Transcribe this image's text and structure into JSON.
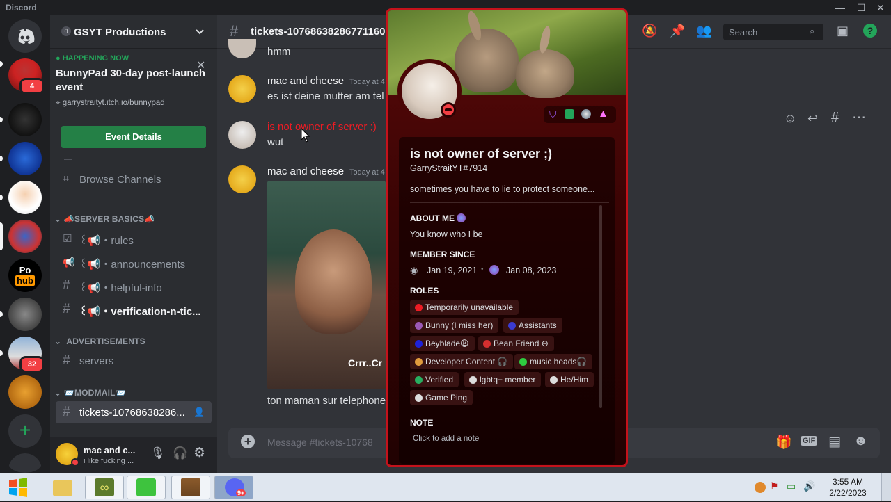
{
  "window": {
    "app_name": "Discord",
    "minimize": "—",
    "maximize": "☐",
    "close": "✕"
  },
  "rail": {
    "badges": {
      "s1": "4",
      "s9": "32"
    },
    "s7_text1": "Po",
    "s7_text2": "hub"
  },
  "guild": {
    "name": "GSYT Productions",
    "boost_count": "0"
  },
  "event": {
    "status": "HAPPENING NOW",
    "title": "BunnyPad 30-day post-launch event",
    "url": "garrystraityt.itch.io/bunnypad",
    "button": "Event Details"
  },
  "channels": {
    "browse": "Browse Channels",
    "cat_server_basics": "📣SERVER BASICS📣",
    "rules": "꒰📢・rules",
    "announcements": "꒰📢・announcements",
    "helpful_info": "꒰📢・helpful-info",
    "verification": "꒰📢・verification-n-tic...",
    "cat_advertisements": "ADVERTISEMENTS",
    "servers": "servers",
    "cat_modmail": "📨MODMAIL📨",
    "tickets": "tickets-10768638286..."
  },
  "user": {
    "name": "mac and c...",
    "status": "i like fucking ..."
  },
  "chat": {
    "channel_title": "tickets-10768638286771160",
    "search_placeholder": "Search",
    "messages": [
      {
        "text": "hmm"
      },
      {
        "author": "mac and cheese",
        "timestamp": "Today at 4",
        "text": "es ist deine mutter am tel"
      },
      {
        "author": "is not owner of server ;)",
        "text": "wut"
      },
      {
        "author": "mac and cheese",
        "timestamp": "Today at 4",
        "image_caption": "Crrr..Cr",
        "text": "ton maman sur telephone"
      }
    ],
    "composer_placeholder": "Message #tickets-10768"
  },
  "profile": {
    "display_name": "is not owner of server ;)",
    "tag": "GarryStraitYT#7914",
    "custom_status": "sometimes you have to lie to protect someone...",
    "about_me_heading": "ABOUT ME",
    "about_me": "You know who I be",
    "member_since_heading": "MEMBER SINCE",
    "discord_since": "Jan 19, 2021",
    "server_since": "Jan 08, 2023",
    "roles_heading": "ROLES",
    "roles": [
      {
        "name": "Temporarily unavailable",
        "color": "#ed1c24"
      },
      {
        "name": "Bunny  (I miss her)",
        "color": "#9b59b6"
      },
      {
        "name": "Assistants",
        "color": "#3b3bd1"
      },
      {
        "name": "Beyblade😩",
        "color": "#1e22d8"
      },
      {
        "name": "Bean Friend ⊖",
        "color": "#d32f2f"
      },
      {
        "name": "Developer Content 🎧",
        "color": "#e09b3d"
      },
      {
        "name": "music heads🎧",
        "color": "#2ecc40"
      },
      {
        "name": "Verified",
        "color": "#27ae60"
      },
      {
        "name": "lgbtq+ member",
        "color": "#dddddd"
      },
      {
        "name": "He/Him",
        "color": "#dddddd"
      },
      {
        "name": "Game Ping",
        "color": "#dddddd"
      }
    ],
    "note_heading": "NOTE",
    "note_placeholder": "Click to add a note"
  },
  "taskbar": {
    "time": "3:55 AM",
    "date": "2/22/2023",
    "discord_badge": "9+"
  },
  "colors": {
    "accent_green": "#248046",
    "popout_border": "#c4121b",
    "online": "#23a55a",
    "dnd": "#f23f43"
  }
}
